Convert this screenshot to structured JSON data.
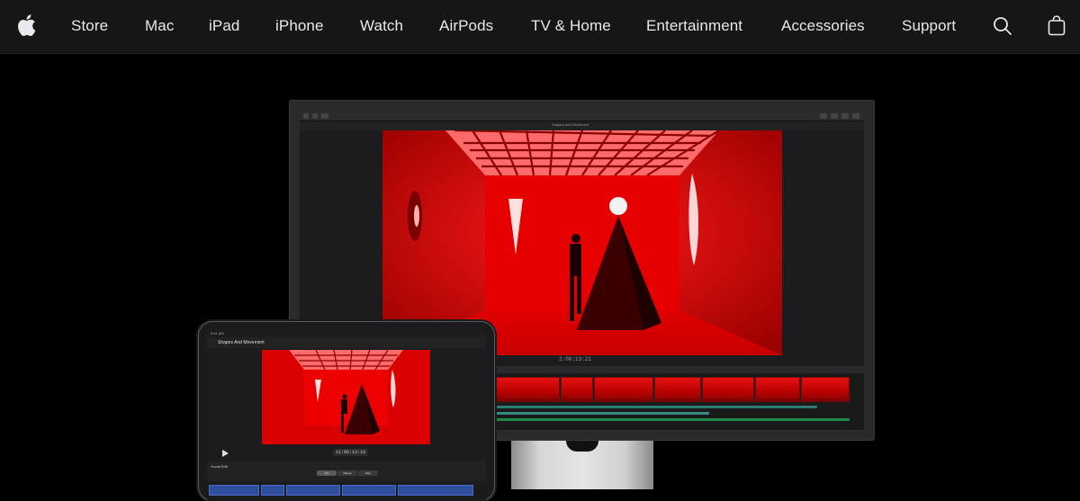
{
  "nav": {
    "links": [
      "Store",
      "Mac",
      "iPad",
      "iPhone",
      "Watch",
      "AirPods",
      "TV & Home",
      "Entertainment",
      "Accessories",
      "Support"
    ],
    "logo_icon": "apple-logo-icon",
    "search_icon": "search-icon",
    "bag_icon": "shopping-bag-icon"
  },
  "hero": {
    "display": {
      "viewer_title": "Shapes and Movement",
      "timecode": "1:00:13:21"
    },
    "ipad": {
      "status_time": "9:41 AM",
      "project_title": "Shapes And Movement",
      "timecode": "11:06:13:10",
      "timeline_title": "Social Edit",
      "segments": [
        "Clip",
        "Range",
        "Edit"
      ]
    }
  },
  "colors": {
    "nav_bg": "#161617",
    "nav_text": "#e8e8ed",
    "page_bg": "#000000",
    "scene_red": "#d40000"
  }
}
